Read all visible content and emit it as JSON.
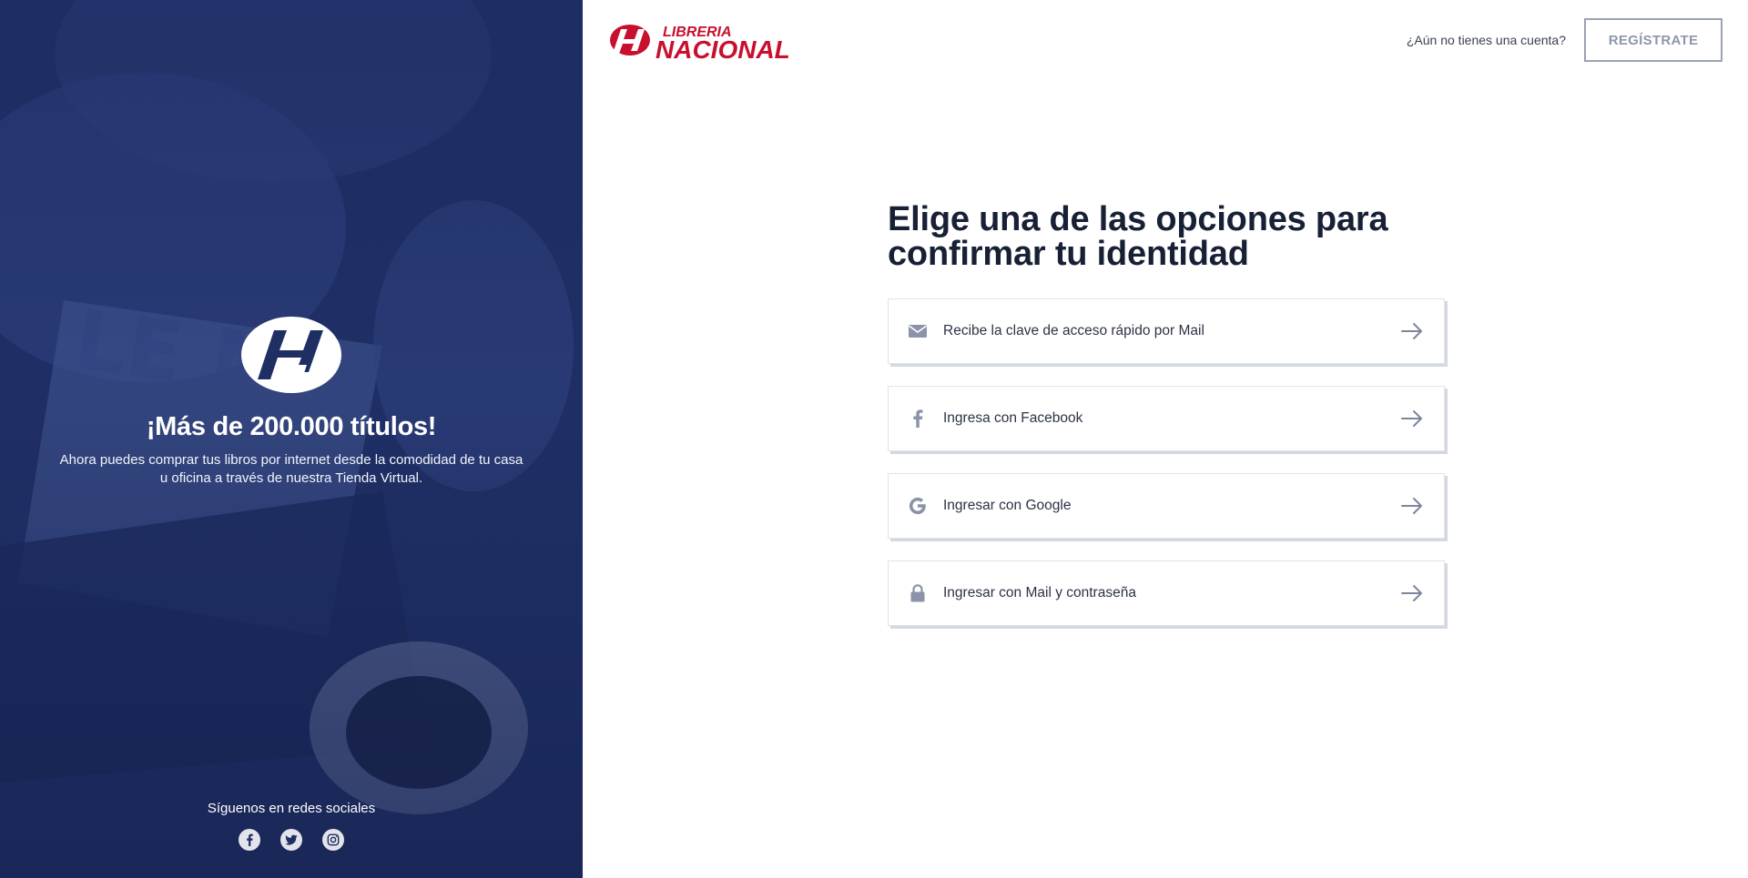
{
  "brand": {
    "line1": "LIBRERIA",
    "line2": "NACIONAL",
    "accent_color": "#c8102e"
  },
  "header": {
    "no_account_text": "¿Aún no tienes una cuenta?",
    "register_label": "REGÍSTRATE"
  },
  "left_panel": {
    "background_color": "#1f2f63",
    "promo_title": "¡Más de 200.000 títulos!",
    "promo_text": "Ahora puedes comprar tus libros por internet desde la comodidad de tu casa u oficina a través de nuestra Tienda Virtual.",
    "social_label": "Síguenos en redes sociales",
    "social_icons": [
      "facebook-icon",
      "twitter-icon",
      "instagram-icon"
    ]
  },
  "main": {
    "title": "Elige una de las opciones para confirmar tu identidad",
    "options": [
      {
        "icon": "envelope-icon",
        "label": "Recibe la clave de acceso rápido por Mail"
      },
      {
        "icon": "facebook-icon",
        "label": "Ingresa con Facebook"
      },
      {
        "icon": "google-icon",
        "label": "Ingresar con Google"
      },
      {
        "icon": "lock-icon",
        "label": "Ingresar con Mail y contraseña"
      }
    ]
  }
}
